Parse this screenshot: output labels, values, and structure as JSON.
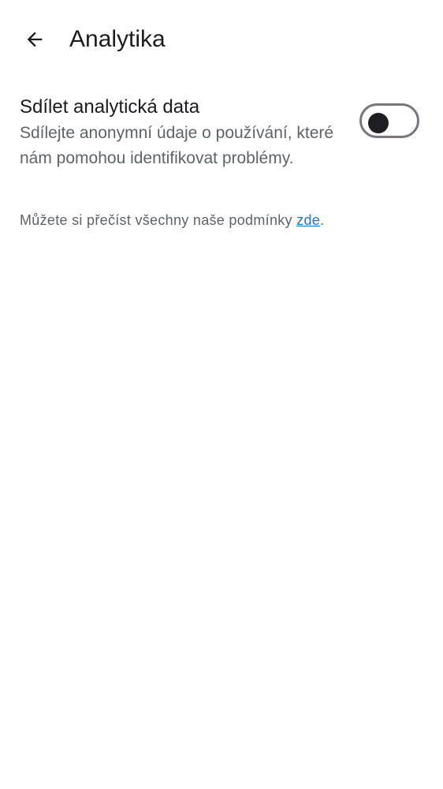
{
  "app_bar": {
    "back_icon": "arrow-back-icon",
    "title": "Analytika"
  },
  "setting": {
    "title": "Sdílet analytická data",
    "description": "Sdílejte anonymní údaje o používání, které nám pomohou identifikovat problémy.",
    "toggle_on": false
  },
  "terms": {
    "prefix": "Můžete si přečíst všechny naše podmínky ",
    "link_label": "zde",
    "suffix": "."
  },
  "colors": {
    "background": "#ffffff",
    "text_primary": "#1c1b1f",
    "text_secondary": "#5f6368",
    "link": "#1a73e8",
    "toggle_outline": "#79747e",
    "toggle_thumb": "#1f1f23"
  }
}
